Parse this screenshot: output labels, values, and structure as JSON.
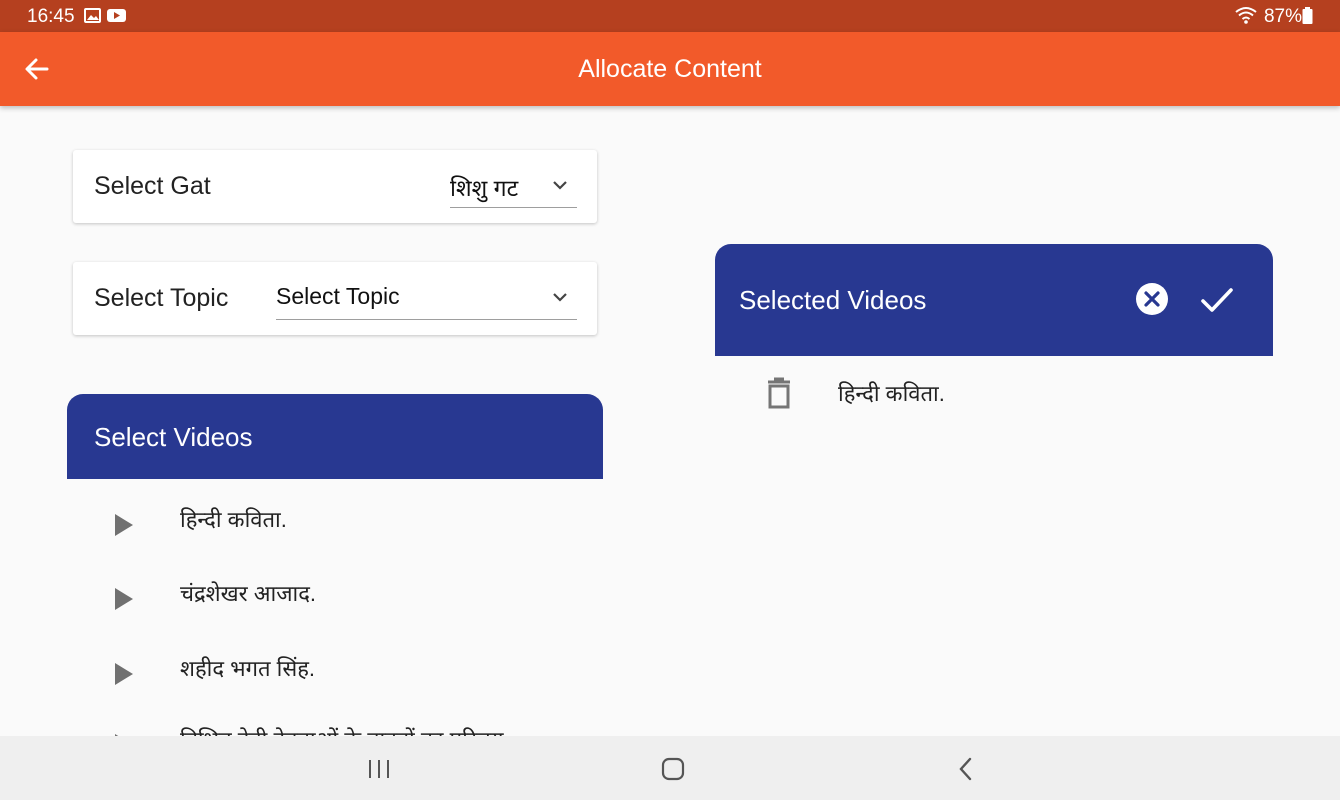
{
  "status_bar": {
    "time": "16:45",
    "battery": "87%",
    "icons": [
      "image-icon",
      "youtube-icon",
      "wifi-icon",
      "battery-icon"
    ]
  },
  "app_bar": {
    "title": "Allocate Content",
    "back_icon": "arrow-left-icon",
    "color": "#f25a2a"
  },
  "gat": {
    "label": "Select Gat",
    "value": "शिशु गट"
  },
  "topic": {
    "label": "Select Topic",
    "value": "Select Topic"
  },
  "select_videos": {
    "header": "Select Videos",
    "items": [
      {
        "title": "हिन्दी कविता."
      },
      {
        "title": "चंद्रशेखर आजाद."
      },
      {
        "title": "शहीद भगत सिंह."
      },
      {
        "title": "विभिन्न देवी देवताओं के वाहनों का परिचय"
      }
    ]
  },
  "selected_videos": {
    "header": "Selected Videos",
    "items": [
      {
        "title": "हिन्दी कविता."
      }
    ]
  },
  "colors": {
    "status_bar": "#b5401f",
    "accent": "#f25a2a",
    "panel_header": "#283891"
  }
}
